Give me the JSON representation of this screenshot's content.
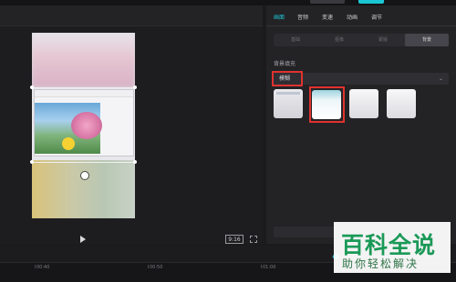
{
  "props": {
    "tabs": [
      "画面",
      "音频",
      "变速",
      "动画",
      "调节"
    ],
    "subtabs": [
      "基础",
      "抠像",
      "蒙版",
      "背景"
    ],
    "section_label": "背景填充",
    "fill_select": {
      "value": "模糊"
    }
  },
  "player": {
    "ratio": "9:16"
  },
  "timeline": {
    "ticks": [
      "00:40",
      "00:50",
      "01:00"
    ]
  },
  "watermark": {
    "title": "百科全说",
    "subtitle": "助你轻松解决"
  },
  "colors": {
    "accent": "#1ac6d4",
    "highlight": "#e0322f",
    "brand_green": "#1aa05a"
  },
  "icons": [
    "play-icon",
    "fullscreen-icon",
    "rotate-icon",
    "chevron-down-icon"
  ]
}
